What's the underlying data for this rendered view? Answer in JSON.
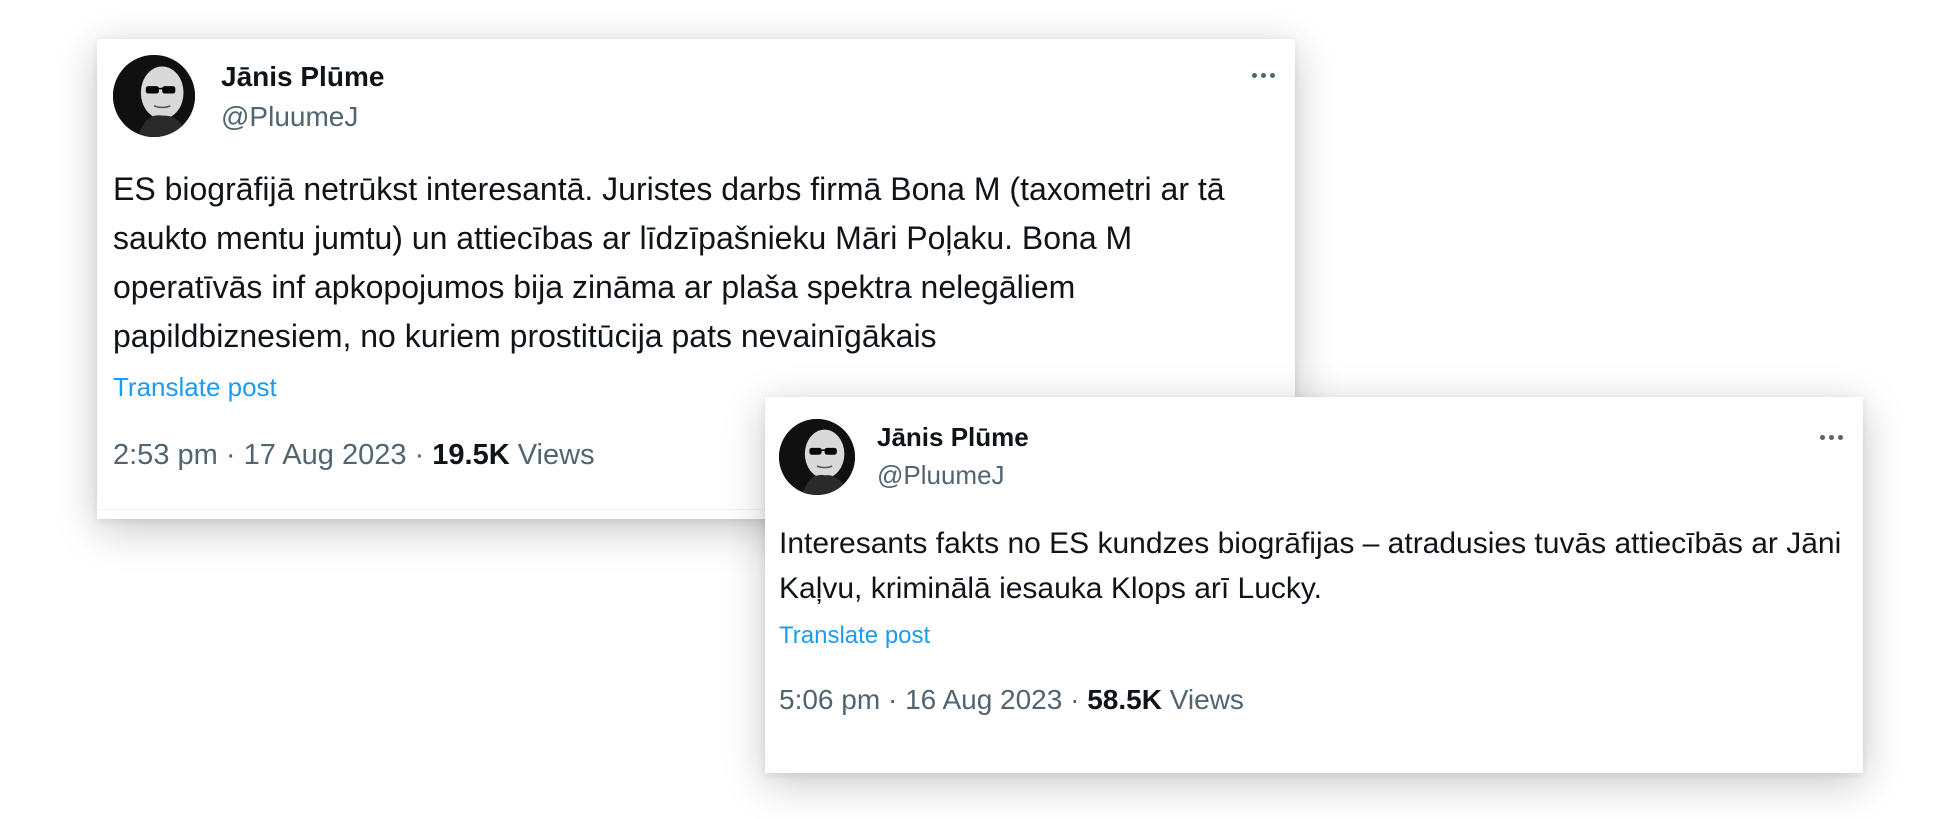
{
  "posts": [
    {
      "author_name": "Jānis Plūme",
      "author_handle": "@PluumeJ",
      "text": "ES biogrāfijā netrūkst interesantā. Juristes darbs firmā Bona M (taxometri ar tā saukto mentu  jumtu) un attiecības ar līdzīpašnieku Māri Poļaku. Bona M operatīvās inf apkopojumos bija zināma ar plaša spektra nelegāliem papildbiznesiem, no kuriem prostitūcija pats nevainīgākais",
      "translate_label": "Translate post",
      "time": "2:53 pm",
      "date": "17 Aug 2023",
      "views_count": "19.5K",
      "views_label": "Views",
      "separator": "·",
      "more_icon": "more-horizontal-icon"
    },
    {
      "author_name": "Jānis Plūme",
      "author_handle": "@PluumeJ",
      "text": "Interesants fakts no ES kundzes biogrāfijas – atradusies tuvās attiecībās ar Jāni Kaļvu, kriminālā iesauka Klops arī Lucky.",
      "translate_label": "Translate post",
      "time": "5:06 pm",
      "date": "16 Aug 2023",
      "views_count": "58.5K",
      "views_label": "Views",
      "separator": "·",
      "more_icon": "more-horizontal-icon"
    }
  ],
  "colors": {
    "text_primary": "#0f1419",
    "text_secondary": "#536471",
    "link": "#1d9bf0",
    "card_background": "#ffffff"
  }
}
